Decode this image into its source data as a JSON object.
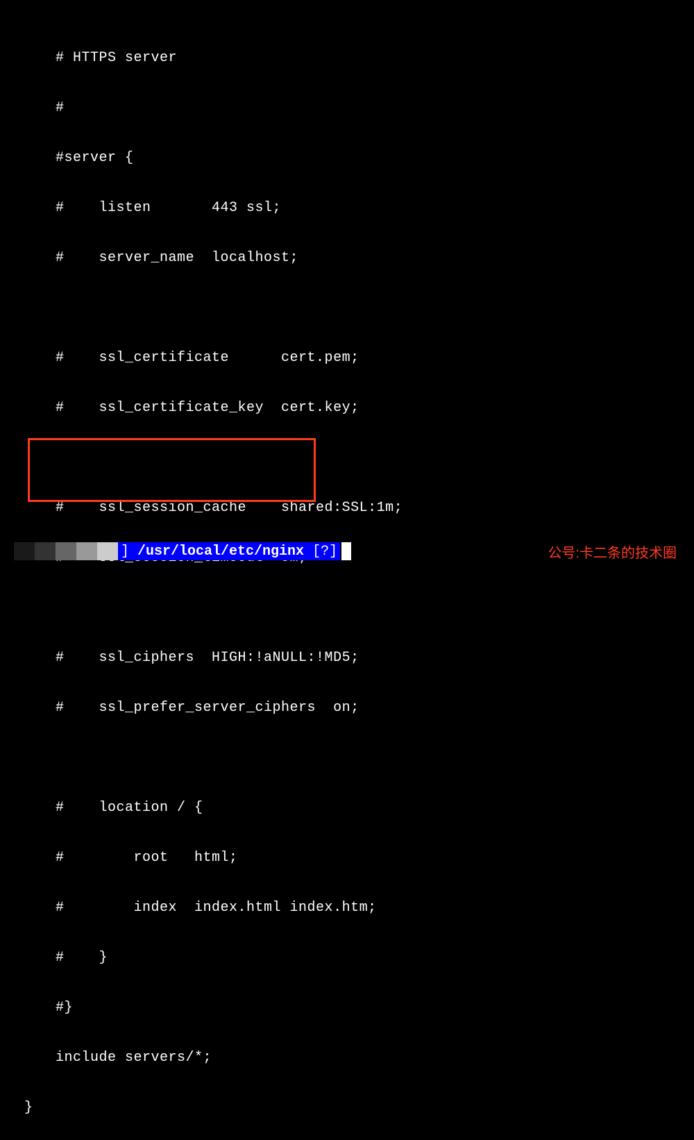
{
  "config_lines": [
    "# HTTPS server",
    "#",
    "#server {",
    "#    listen       443 ssl;",
    "#    server_name  localhost;",
    "",
    "#    ssl_certificate      cert.pem;",
    "#    ssl_certificate_key  cert.key;",
    "",
    "#    ssl_session_cache    shared:SSL:1m;",
    "#    ssl_session_timeout  5m;",
    "",
    "#    ssl_ciphers  HIGH:!aNULL:!MD5;",
    "#    ssl_prefer_server_ciphers  on;",
    "",
    "#    location / {",
    "#        root   html;",
    "#        index  index.html index.htm;",
    "#    }",
    "#}",
    "include servers/*;"
  ],
  "closing_brace": "}",
  "status_bar": {
    "bracket_left": "]",
    "path": "/usr/local/etc/nginx",
    "bracket_right": "[?]"
  },
  "watermark": "公号:卡二条的技术圈"
}
